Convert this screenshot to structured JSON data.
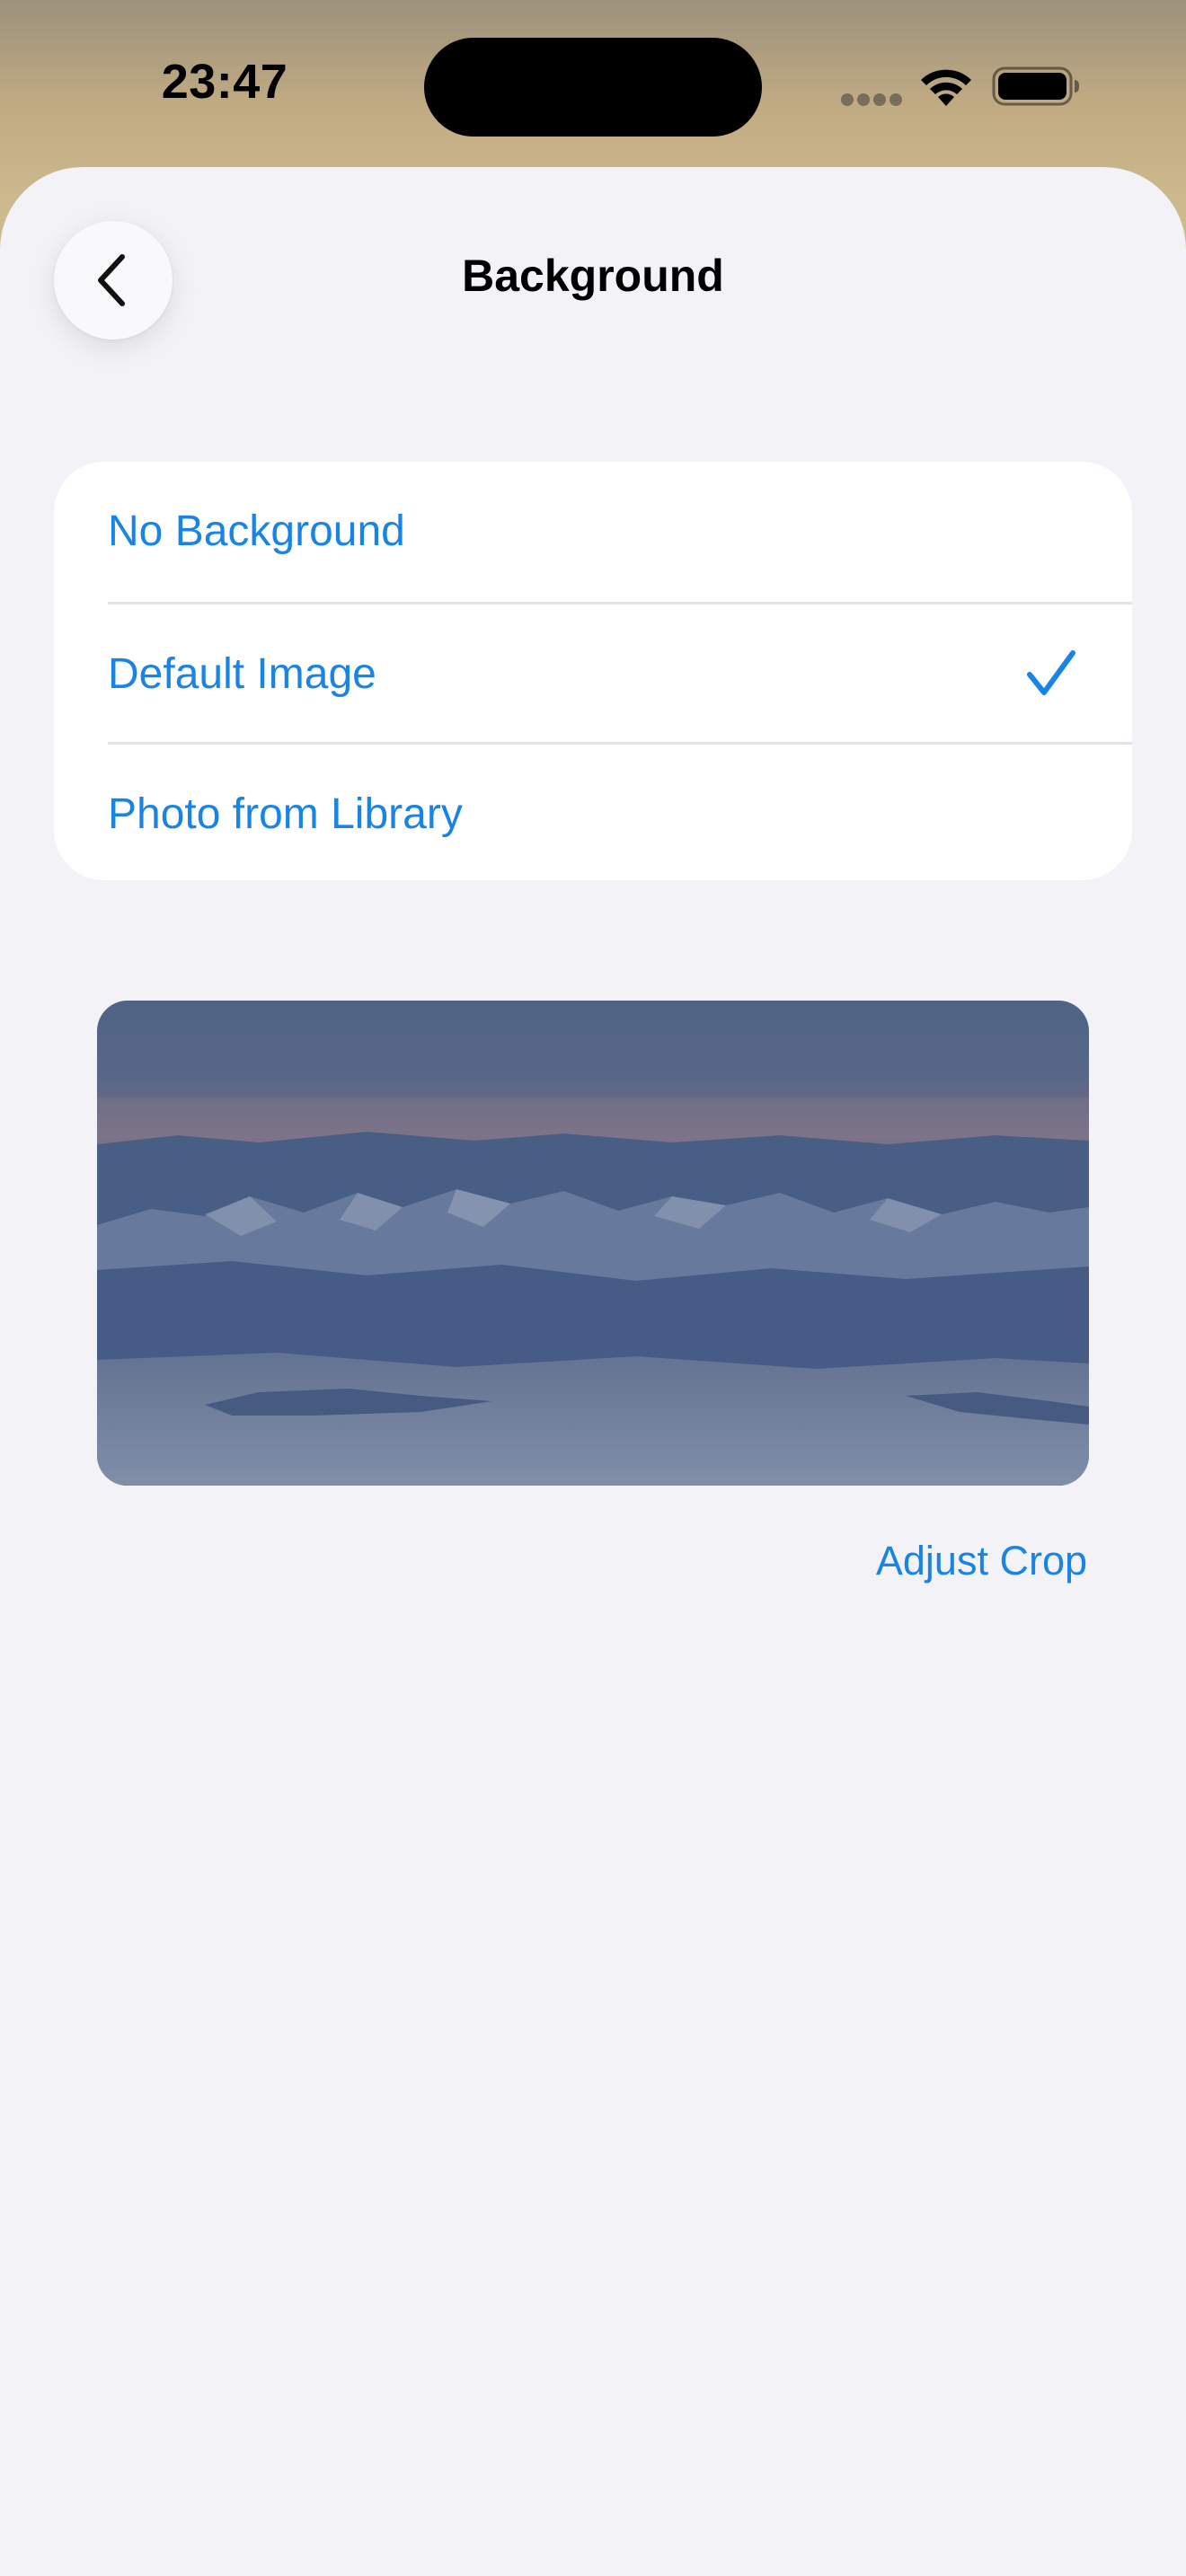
{
  "status_bar": {
    "time": "23:47",
    "icons": [
      "cellular-dots-icon",
      "wifi-icon",
      "battery-icon"
    ]
  },
  "header": {
    "title": "Background",
    "back_icon": "chevron-left-icon"
  },
  "options": [
    {
      "label": "No Background",
      "selected": false
    },
    {
      "label": "Default Image",
      "selected": true
    },
    {
      "label": "Photo from Library",
      "selected": false
    }
  ],
  "preview": {
    "icon": "mountain-landscape-image"
  },
  "actions": {
    "adjust_crop": "Adjust Crop"
  },
  "colors": {
    "accent": "#1a84e5",
    "sheet_background": "#f2f2f7",
    "card_background": "#ffffff",
    "divider": "#e3e3e8"
  }
}
